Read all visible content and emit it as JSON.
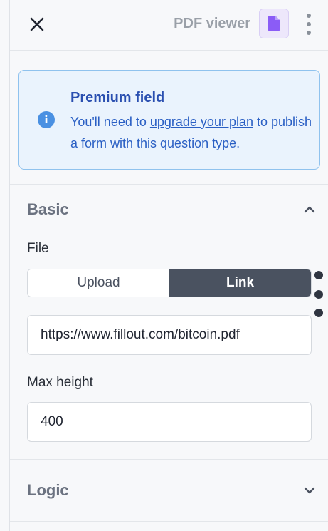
{
  "header": {
    "title": "PDF viewer",
    "type_icon": "pdf-file-icon",
    "type_icon_color": "#8b5cf6"
  },
  "premium": {
    "title": "Premium field",
    "text_before": "You'll need to ",
    "link_text": "upgrade your plan",
    "text_after": " to publish a form with this question type."
  },
  "basic": {
    "title": "Basic",
    "file_label": "File",
    "toggle": {
      "upload_label": "Upload",
      "link_label": "Link",
      "selected": "Link"
    },
    "file_url": "https://www.fillout.com/bitcoin.pdf",
    "max_height_label": "Max height",
    "max_height_value": "400"
  },
  "logic": {
    "title": "Logic"
  },
  "colors": {
    "accent_dark": "#4a5260",
    "premium_bg": "#eaf3fd",
    "premium_border": "#8fc2ee",
    "info_blue": "#4a90e2"
  }
}
